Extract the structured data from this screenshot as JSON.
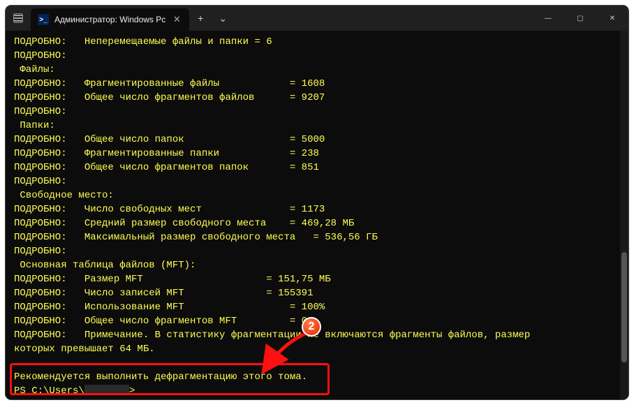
{
  "title": "Администратор: Windows Pc",
  "ps_icon": ">_",
  "controls": {
    "new_tab": "+",
    "dropdown": "⌄",
    "min": "—",
    "max": "▢",
    "close": "✕",
    "tab_close": "✕"
  },
  "lines": [
    "ПОДРОБНО:   Неперемещаемые файлы и папки = 6",
    "ПОДРОБНО:",
    " Файлы:",
    "ПОДРОБНО:   Фрагментированные файлы            = 1608",
    "ПОДРОБНО:   Общее число фрагментов файлов      = 9207",
    "ПОДРОБНО:",
    " Папки:",
    "ПОДРОБНО:   Общее число папок                  = 5000",
    "ПОДРОБНО:   Фрагментированные папки            = 238",
    "ПОДРОБНО:   Общее число фрагментов папок       = 851",
    "ПОДРОБНО:",
    " Свободное место:",
    "ПОДРОБНО:   Число свободных мест               = 1173",
    "ПОДРОБНО:   Средний размер свободного места    = 469,28 МБ",
    "ПОДРОБНО:   Максимальный размер свободного места   = 536,56 ГБ",
    "ПОДРОБНО:",
    " Основная таблица файлов (MFT):",
    "ПОДРОБНО:   Размер MFT                     = 151,75 МБ",
    "ПОДРОБНО:   Число записей MFT              = 155391",
    "ПОДРОБНО:   Использование MFT                  = 100%",
    "ПОДРОБНО:   Общее число фрагментов MFT         = 0",
    "ПОДРОБНО:   Примечание. В статистику фрагментации не включаются фрагменты файлов, размер",
    "которых превышает 64 МБ.",
    "",
    "Рекомендуется выполнить дефрагментацию этого тома."
  ],
  "prompt_prefix": "PS C:\\Users\\",
  "prompt_suffix": ">",
  "badge": "2"
}
